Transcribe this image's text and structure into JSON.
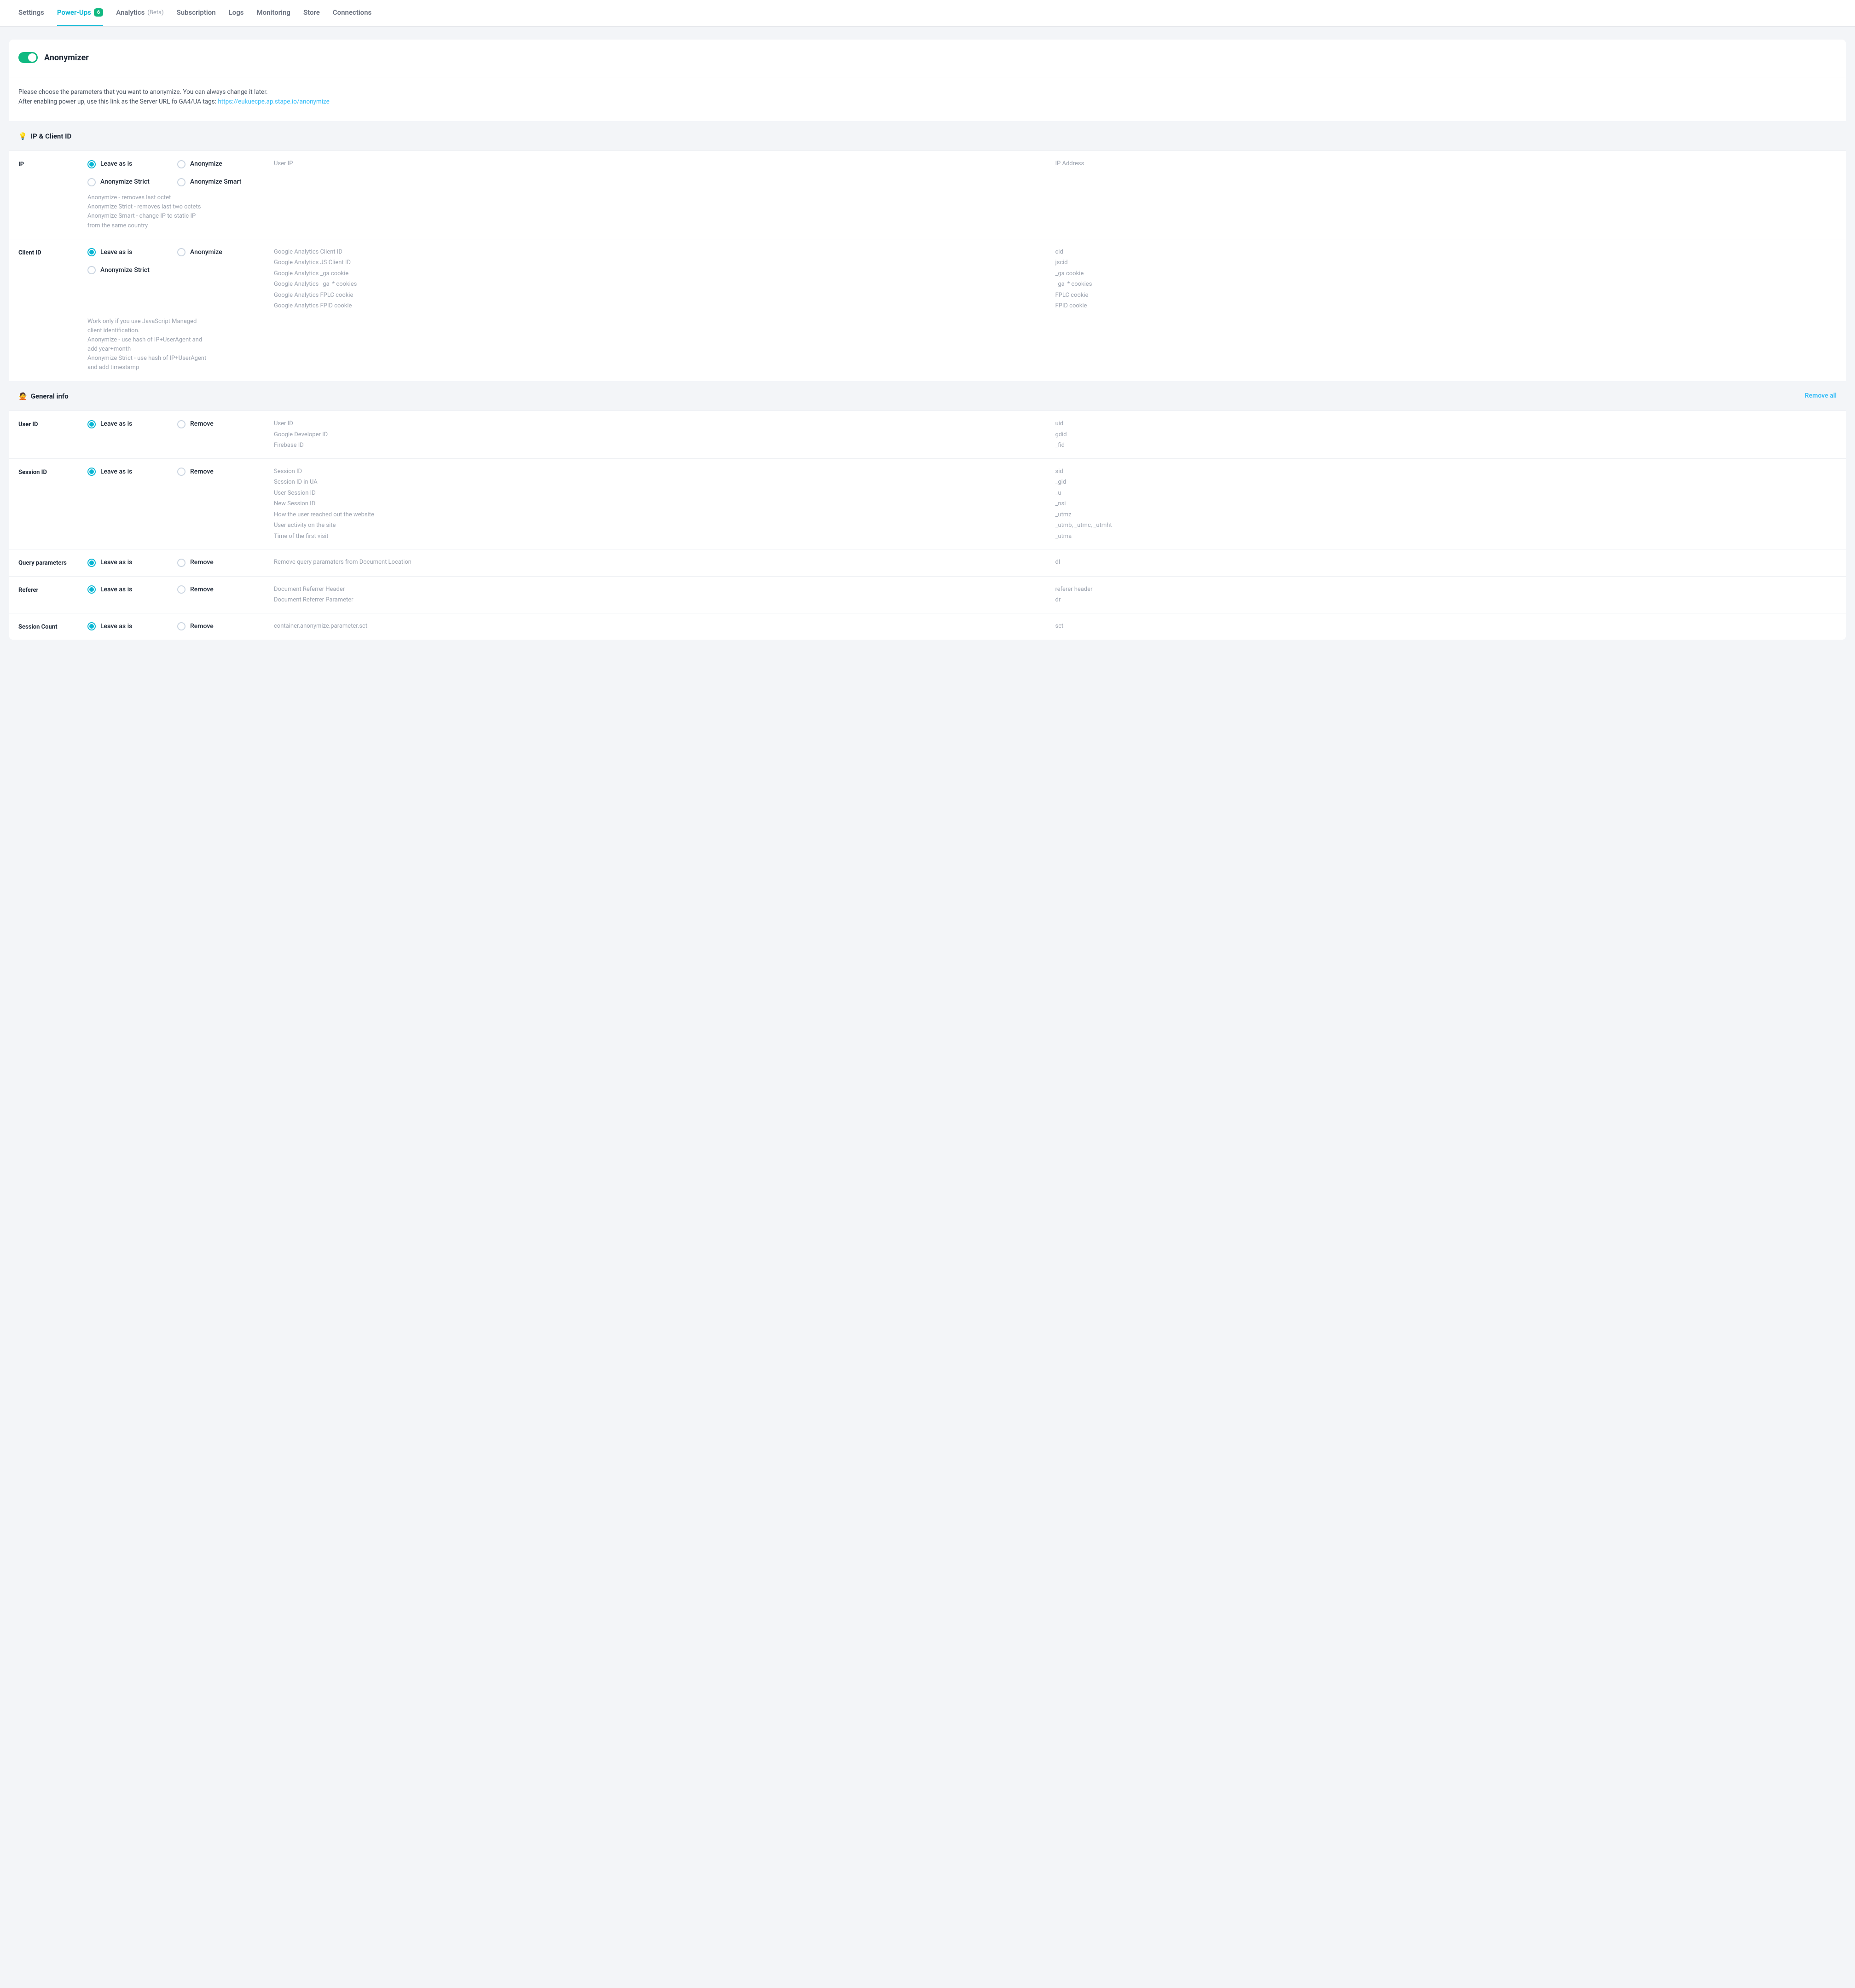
{
  "tabs": [
    {
      "label": "Settings",
      "active": false
    },
    {
      "label": "Power-Ups",
      "active": true,
      "badge": "6"
    },
    {
      "label": "Analytics",
      "suffix": "(Beta)",
      "active": false
    },
    {
      "label": "Subscription",
      "active": false
    },
    {
      "label": "Logs",
      "active": false
    },
    {
      "label": "Monitoring",
      "active": false
    },
    {
      "label": "Store",
      "active": false
    },
    {
      "label": "Connections",
      "active": false
    }
  ],
  "card": {
    "title": "Anonymizer",
    "desc_line1": "Please choose the parameters that you want to anonymize. You can always change it later.",
    "desc_line2_prefix": "After enabling power up, use this link as the Server URL fo GA4/UA tags: ",
    "desc_link": "https://eukuecpe.ap.stape.io/anonymize"
  },
  "sections": [
    {
      "icon": "💡",
      "title": "IP & Client ID",
      "remove_all": false,
      "rows": [
        {
          "label": "IP",
          "options_col1": [
            {
              "label": "Leave as is",
              "checked": true
            },
            {
              "label": "Anonymize Strict",
              "checked": false
            }
          ],
          "options_col2": [
            {
              "label": "Anonymize",
              "checked": false
            },
            {
              "label": "Anonymize Smart",
              "checked": false
            }
          ],
          "helper": "Anonymize - removes last octet\nAnonymize Strict - removes last two octets\nAnonymize Smart - change IP to static IP from the same country",
          "desc_col": [
            "User IP"
          ],
          "code_col": [
            "IP Address"
          ]
        },
        {
          "label": "Client ID",
          "options_col1": [
            {
              "label": "Leave as is",
              "checked": true
            },
            {
              "label": "Anonymize Strict",
              "checked": false
            }
          ],
          "options_col2": [
            {
              "label": "Anonymize",
              "checked": false
            }
          ],
          "helper": "Work only if you use JavaScript Managed client identification.\nAnonymize - use hash of IP+UserAgent and add year+month\nAnonymize Strict - use hash of IP+UserAgent and add timestamp",
          "desc_col": [
            "Google Analytics Client ID",
            "Google Analytics JS Client ID",
            "Google Analytics _ga cookie",
            "Google Analytics _ga_* cookies",
            "Google Analytics FPLC cookie",
            "Google Analytics FPID cookie"
          ],
          "code_col": [
            "cid",
            "jscid",
            "_ga cookie",
            "_ga_* cookies",
            "FPLC cookie",
            "FPID cookie"
          ]
        }
      ]
    },
    {
      "icon": "🙅",
      "title": "General info",
      "remove_all": true,
      "remove_all_label": "Remove all",
      "rows": [
        {
          "label": "User ID",
          "options_col1": [
            {
              "label": "Leave as is",
              "checked": true
            }
          ],
          "options_col2": [
            {
              "label": "Remove",
              "checked": false
            }
          ],
          "desc_col": [
            "User ID",
            "Google Developer ID",
            "Firebase ID"
          ],
          "code_col": [
            "uid",
            "gdid",
            "_fid"
          ]
        },
        {
          "label": "Session ID",
          "options_col1": [
            {
              "label": "Leave as is",
              "checked": true
            }
          ],
          "options_col2": [
            {
              "label": "Remove",
              "checked": false
            }
          ],
          "desc_col": [
            "Session ID",
            "Session ID in UA",
            "User Session ID",
            "New Session ID",
            "How the user reached out the website",
            "User activity on the site",
            "Time of the first visit"
          ],
          "code_col": [
            "sid",
            "_gid",
            "_u",
            "_nsi",
            "_utmz",
            "_utmb, _utmc, _utmht",
            "_utma"
          ]
        },
        {
          "label": "Query parameters",
          "options_col1": [
            {
              "label": "Leave as is",
              "checked": true
            }
          ],
          "options_col2": [
            {
              "label": "Remove",
              "checked": false
            }
          ],
          "desc_col": [
            "Remove query paramaters from Document Location"
          ],
          "code_col": [
            "dl"
          ]
        },
        {
          "label": "Referer",
          "options_col1": [
            {
              "label": "Leave as is",
              "checked": true
            }
          ],
          "options_col2": [
            {
              "label": "Remove",
              "checked": false
            }
          ],
          "desc_col": [
            "Document Referrer Header",
            "Document Referrer Parameter"
          ],
          "code_col": [
            "referer header",
            "dr"
          ]
        },
        {
          "label": "Session Count",
          "options_col1": [
            {
              "label": "Leave as is",
              "checked": true
            }
          ],
          "options_col2": [
            {
              "label": "Remove",
              "checked": false
            }
          ],
          "desc_col": [
            "container.anonymize.parameter.sct"
          ],
          "code_col": [
            "sct"
          ]
        }
      ]
    }
  ]
}
